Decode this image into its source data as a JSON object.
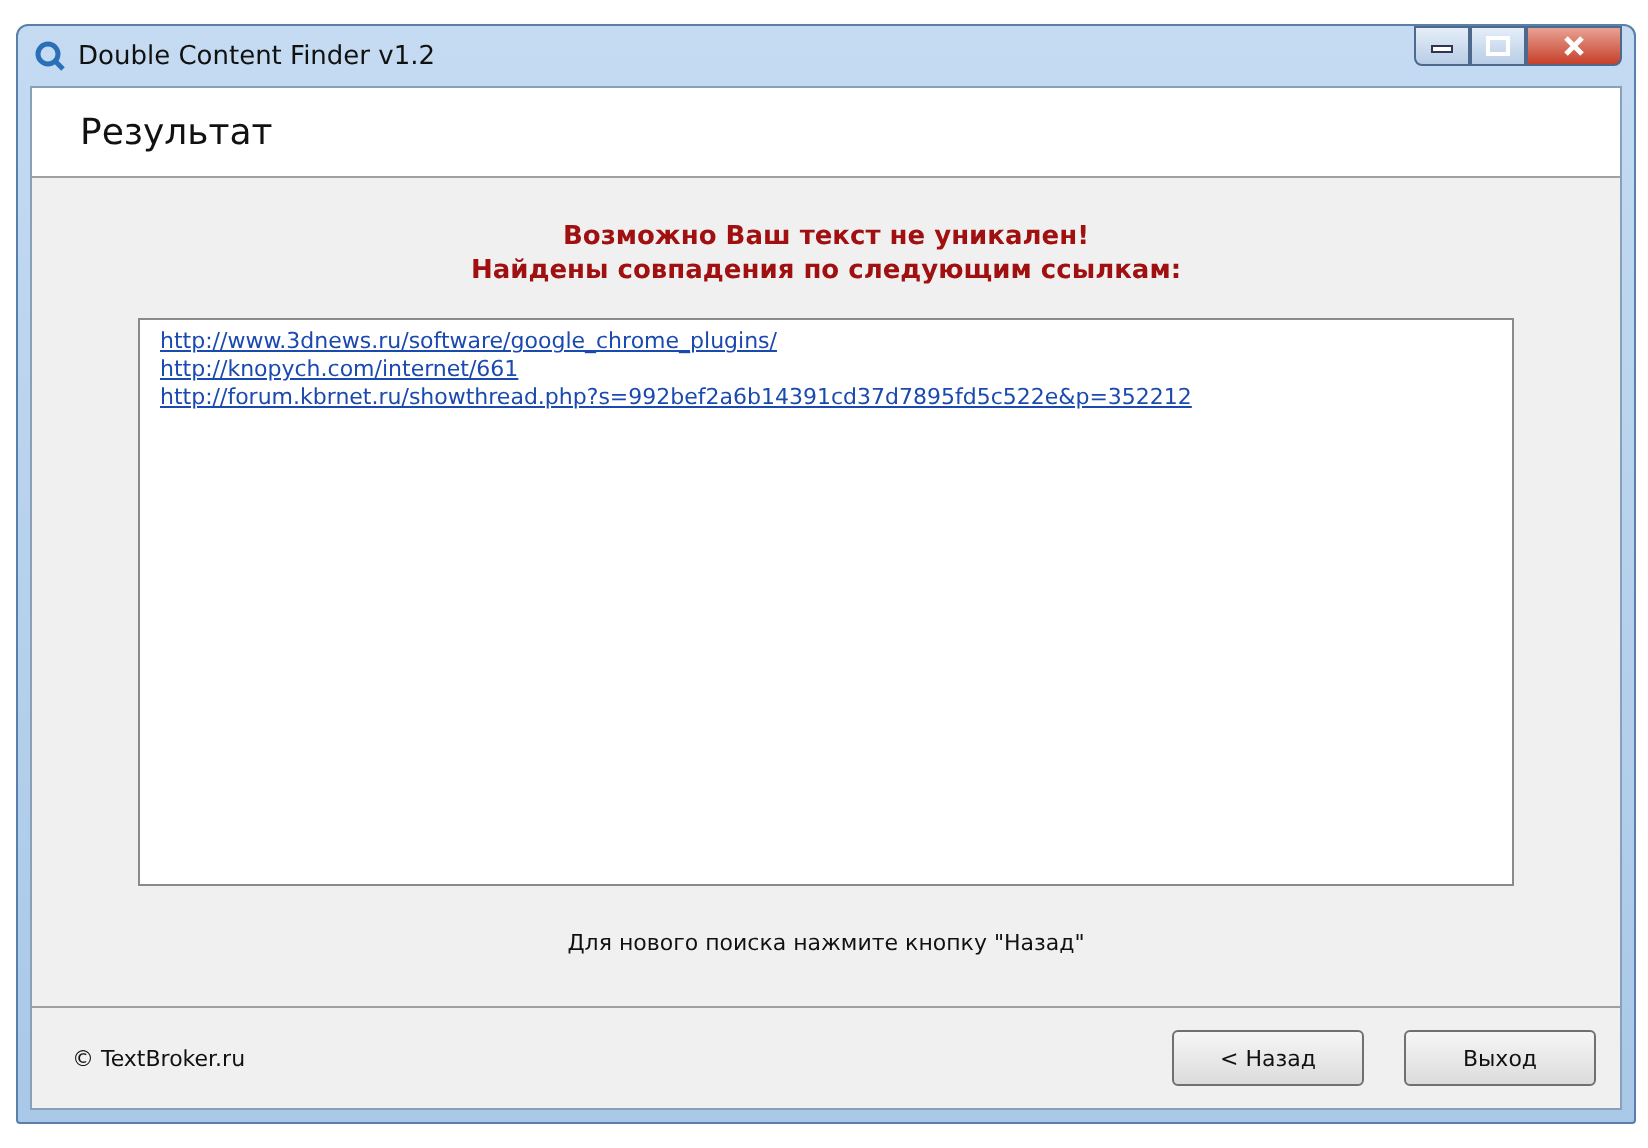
{
  "window": {
    "title": "Double Content Finder v1.2"
  },
  "header": {
    "title": "Результат"
  },
  "message": [
    "Возможно Ваш текст не уникален!",
    "Найдены совпадения по следующим ссылкам:"
  ],
  "links": [
    "http://www.3dnews.ru/software/google_chrome_plugins/",
    "http://knopych.com/internet/661",
    "http://forum.kbrnet.ru/showthread.php?s=992bef2a6b14391cd37d7895fd5c522e&p=352212"
  ],
  "hint": "Для нового поиска нажмите кнопку \"Назад\"",
  "footer": {
    "copyright": "© TextBroker.ru",
    "buttons": [
      "< Назад",
      "Выход"
    ]
  }
}
